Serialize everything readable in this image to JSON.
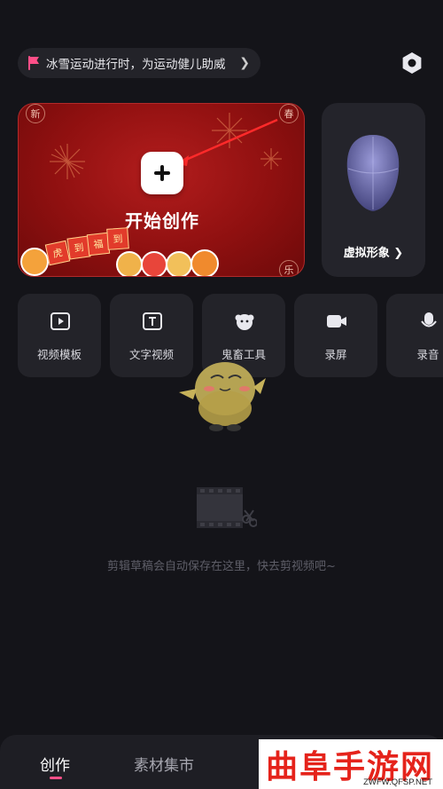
{
  "banner": {
    "text": "冰雪运动进行时，为运动健儿助威",
    "chevron": "❯",
    "flag_color": "#ff4f88"
  },
  "start_card": {
    "label": "开始创作",
    "corners": [
      "新",
      "春",
      "乐"
    ],
    "stickers": [
      "虎",
      "到",
      "福",
      "到"
    ],
    "background": "#9c1414"
  },
  "avatar_card": {
    "label": "虚拟形象 ❯"
  },
  "tools": [
    {
      "label": "视频模板",
      "icon": "video-template-icon"
    },
    {
      "label": "文字视频",
      "icon": "text-video-icon"
    },
    {
      "label": "鬼畜工具",
      "icon": "remix-tool-icon"
    },
    {
      "label": "录屏",
      "icon": "screen-record-icon"
    },
    {
      "label": "录音",
      "icon": "microphone-icon"
    }
  ],
  "empty_state": {
    "text": "剪辑草稿会自动保存在这里，快去剪视频吧~"
  },
  "bottom_nav": {
    "tabs": [
      {
        "label": "创作",
        "active": true
      },
      {
        "label": "素材集市",
        "active": false
      }
    ],
    "indicator_color": "#ff4f88"
  },
  "watermark": {
    "title": "曲阜手游网",
    "url": "ZWFW.QFSP.NET"
  }
}
